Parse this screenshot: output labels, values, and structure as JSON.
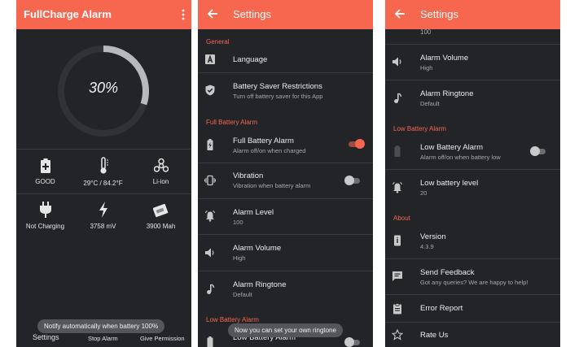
{
  "main": {
    "app_title": "FullCharge Alarm",
    "battery_percent": "30%",
    "battery_level": 0.3,
    "stats": [
      {
        "label": "GOOD",
        "icon": "battery-health-icon"
      },
      {
        "label": "29°C / 84.2°F",
        "icon": "thermometer-icon"
      },
      {
        "label": "Li-ion",
        "icon": "technology-icon"
      },
      {
        "label": "Not Charging",
        "icon": "plug-icon"
      },
      {
        "label": "3758 mV",
        "icon": "voltage-bolt-icon"
      },
      {
        "label": "3900 Mah",
        "icon": "battery-capacity-icon"
      }
    ],
    "toast": "Notify automatically when battery 100%",
    "nav": [
      "Settings",
      "Stop Alarm",
      "Give Permission"
    ]
  },
  "settings": {
    "title": "Settings",
    "general_header": "General",
    "language": "Language",
    "battery_saver_title": "Battery Saver Restrictions",
    "battery_saver_sub": "Turn off battery saver for this App",
    "full_header": "Full Battery Alarm",
    "full_alarm_title": "Full Battery Alarm",
    "full_alarm_sub": "Alarm off/on when charged",
    "vibration_title": "Vibration",
    "vibration_sub": "Vibration when battery alarm",
    "alarm_level_title": "Alarm Level",
    "alarm_level_value": "100",
    "alarm_volume_title": "Alarm Volume",
    "alarm_volume_value": "High",
    "ringtone_title": "Alarm Ringtone",
    "ringtone_value": "Default",
    "low_header": "Low Battery Alarm",
    "low_alarm_title": "Low Battery Alarm",
    "low_alarm_sub": "Alarm off/on when battery low",
    "toast": "Now you can set your own ringtone"
  },
  "settings2": {
    "title": "Settings",
    "top_value": "100",
    "alarm_volume_title": "Alarm Volume",
    "alarm_volume_value": "High",
    "ringtone_title": "Alarm Ringtone",
    "ringtone_value": "Default",
    "low_header": "Low Battery Alarm",
    "low_alarm_title": "Low Battery Alarm",
    "low_alarm_sub": "Alarm off/on when battery low",
    "low_level_title": "Low battery level",
    "low_level_value": "20",
    "about_header": "About",
    "version_title": "Version",
    "version_value": "4.3.9",
    "feedback_title": "Send Feedback",
    "feedback_sub": "Got any queries? We are happy to help!",
    "error_report": "Error Report",
    "rate_us": "Rate Us"
  },
  "colors": {
    "accent": "#f7664f",
    "background": "#222428",
    "subtext": "#a6a8ab"
  }
}
